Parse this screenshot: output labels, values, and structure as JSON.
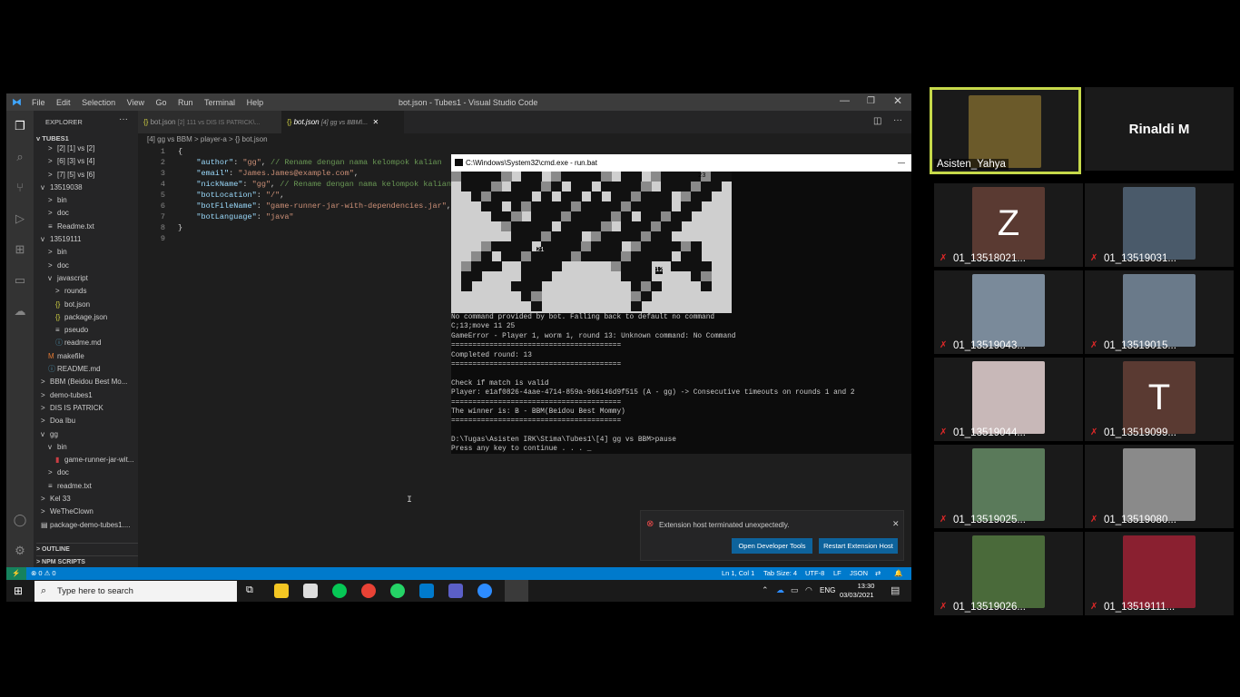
{
  "vscode": {
    "window_title": "bot.json - Tubes1 - Visual Studio Code",
    "menu": [
      "File",
      "Edit",
      "Selection",
      "View",
      "Go",
      "Run",
      "Terminal",
      "Help"
    ],
    "explorer_label": "EXPLORER",
    "workspace_label": "TUBES1",
    "tree": [
      {
        "label": "[2] [1] vs [2]",
        "indent": 1,
        "chev": ">"
      },
      {
        "label": "[6] [3] vs [4]",
        "indent": 1,
        "chev": ">"
      },
      {
        "label": "[7] [5] vs [6]",
        "indent": 1,
        "chev": ">"
      },
      {
        "label": "13519038",
        "indent": 0,
        "chev": "v"
      },
      {
        "label": "bin",
        "indent": 1,
        "chev": ">"
      },
      {
        "label": "doc",
        "indent": 1,
        "chev": ">"
      },
      {
        "label": "Readme.txt",
        "indent": 1,
        "chev": "≡"
      },
      {
        "label": "13519111",
        "indent": 0,
        "chev": "v"
      },
      {
        "label": "bin",
        "indent": 1,
        "chev": ">"
      },
      {
        "label": "doc",
        "indent": 1,
        "chev": ">"
      },
      {
        "label": "javascript",
        "indent": 1,
        "chev": "v"
      },
      {
        "label": "rounds",
        "indent": 2,
        "chev": ">"
      },
      {
        "label": "bot.json",
        "indent": 2,
        "chev": "{}"
      },
      {
        "label": "package.json",
        "indent": 2,
        "chev": "{}"
      },
      {
        "label": "pseudo",
        "indent": 2,
        "chev": "≡"
      },
      {
        "label": "readme.md",
        "indent": 2,
        "chev": "ⓘ"
      },
      {
        "label": "makefile",
        "indent": 1,
        "chev": "M"
      },
      {
        "label": "README.md",
        "indent": 1,
        "chev": "ⓘ"
      },
      {
        "label": "BBM (Beidou Best Mo...",
        "indent": 0,
        "chev": ">"
      },
      {
        "label": "demo-tubes1",
        "indent": 0,
        "chev": ">"
      },
      {
        "label": "DIS IS PATRICK",
        "indent": 0,
        "chev": ">"
      },
      {
        "label": "Doa Ibu",
        "indent": 0,
        "chev": ">"
      },
      {
        "label": "gg",
        "indent": 0,
        "chev": "v"
      },
      {
        "label": "bin",
        "indent": 1,
        "chev": "v"
      },
      {
        "label": "game-runner-jar-wit...",
        "indent": 2,
        "chev": "▮"
      },
      {
        "label": "doc",
        "indent": 1,
        "chev": ">"
      },
      {
        "label": "readme.txt",
        "indent": 1,
        "chev": "≡"
      },
      {
        "label": "Kel 33",
        "indent": 0,
        "chev": ">"
      },
      {
        "label": "WeTheClown",
        "indent": 0,
        "chev": ">"
      },
      {
        "label": "package-demo-tubes1....",
        "indent": 0,
        "chev": "▤"
      }
    ],
    "outline_label": "OUTLINE",
    "npm_label": "NPM SCRIPTS",
    "tab1": {
      "name": "bot.json",
      "detail": "[2] 111 vs DIS IS PATRICK\\..."
    },
    "tab2": {
      "name": "bot.json",
      "detail": "[4] gg vs BBM\\..."
    },
    "breadcrumb": [
      "[4] gg vs BBM",
      "player-a",
      "{} bot.json"
    ],
    "line_numbers": [
      "1",
      "2",
      "3",
      "4",
      "5",
      "6",
      "7",
      "8",
      "9"
    ],
    "code": {
      "l1": "{",
      "author_k": "\"author\"",
      "author_v": "\"gg\"",
      "author_c": "// Rename dengan nama kelompok kalian",
      "email_k": "\"email\"",
      "email_v": "\"James.James@example.com\"",
      "nick_k": "\"nickName\"",
      "nick_v": "\"gg\"",
      "nick_c": "// Rename dengan nama kelompok kalian",
      "loc_k": "\"botLocation\"",
      "loc_v": "\"/\"",
      "file_k": "\"botFileName\"",
      "file_v": "\"game-runner-jar-with-dependencies.jar\"",
      "lang_k": "\"botLanguage\"",
      "lang_v": "\"java\"",
      "l8": "}"
    },
    "status": {
      "errors": "⊗ 0 ⚠ 0",
      "position": "Ln 1, Col 1",
      "tab_size": "Tab Size: 4",
      "encoding": "UTF-8",
      "eol": "LF",
      "language": "JSON"
    },
    "notification": {
      "message": "Extension host terminated unexpectedly.",
      "btn_dev": "Open Developer Tools",
      "btn_restart": "Restart Extension Host"
    }
  },
  "cmd": {
    "title": "C:\\Windows\\System32\\cmd.exe - run.bat",
    "map_labels": [
      "23",
      "21",
      "12"
    ],
    "output": [
      "No command provided by bot. Falling back to default no command",
      "C;13;move 11 25",
      "GameError - Player 1, worm 1, round 13: Unknown command: No Command",
      "========================================",
      "Completed round: 13",
      "========================================",
      "",
      "Check if match is valid",
      "Player: e1af0826-4aae-4714-859a-966146d9f515 (A - gg) -> Consecutive timeouts on rounds 1 and 2",
      "========================================",
      "The winner is: B - BBM(Beidou Best Mommy)",
      "========================================",
      "",
      "D:\\Tugas\\Asisten IRK\\Stima\\Tubes1\\[4] gg vs BBM>pause",
      "Press any key to continue . . . _"
    ]
  },
  "taskbar": {
    "search_placeholder": "Type here to search",
    "lang": "ENG",
    "time": "13:30",
    "date": "03/03/2021"
  },
  "gallery": {
    "tiles": [
      {
        "name": "Asisten_Yahya",
        "active": true,
        "muted": false,
        "photo": "#6b5a2a",
        "letter": ""
      },
      {
        "name": "Rinaldi M",
        "active": false,
        "muted": false,
        "photo": "",
        "letter": "",
        "big": true
      },
      {
        "name": "01_13518021...",
        "muted": true,
        "photo": "#5a3a32",
        "letter": "Z"
      },
      {
        "name": "01_13519031...",
        "muted": true,
        "photo": "#4a5a6a",
        "letter": ""
      },
      {
        "name": "01_13519043...",
        "muted": true,
        "photo": "#7a8a9a",
        "letter": ""
      },
      {
        "name": "01_13519015...",
        "muted": true,
        "photo": "#6a7a8a",
        "letter": ""
      },
      {
        "name": "01_13519044...",
        "muted": true,
        "photo": "#c8b8b8",
        "letter": ""
      },
      {
        "name": "01_13519099...",
        "muted": true,
        "photo": "#5a3a32",
        "letter": "T"
      },
      {
        "name": "01_13519025...",
        "muted": true,
        "photo": "#5a7a5a",
        "letter": ""
      },
      {
        "name": "01_13519080...",
        "muted": true,
        "photo": "#8a8a8a",
        "letter": ""
      },
      {
        "name": "01_13519026...",
        "muted": true,
        "photo": "#4a6a3a",
        "letter": ""
      },
      {
        "name": "01_13519111...",
        "muted": true,
        "photo": "#8a2030",
        "letter": ""
      }
    ]
  }
}
